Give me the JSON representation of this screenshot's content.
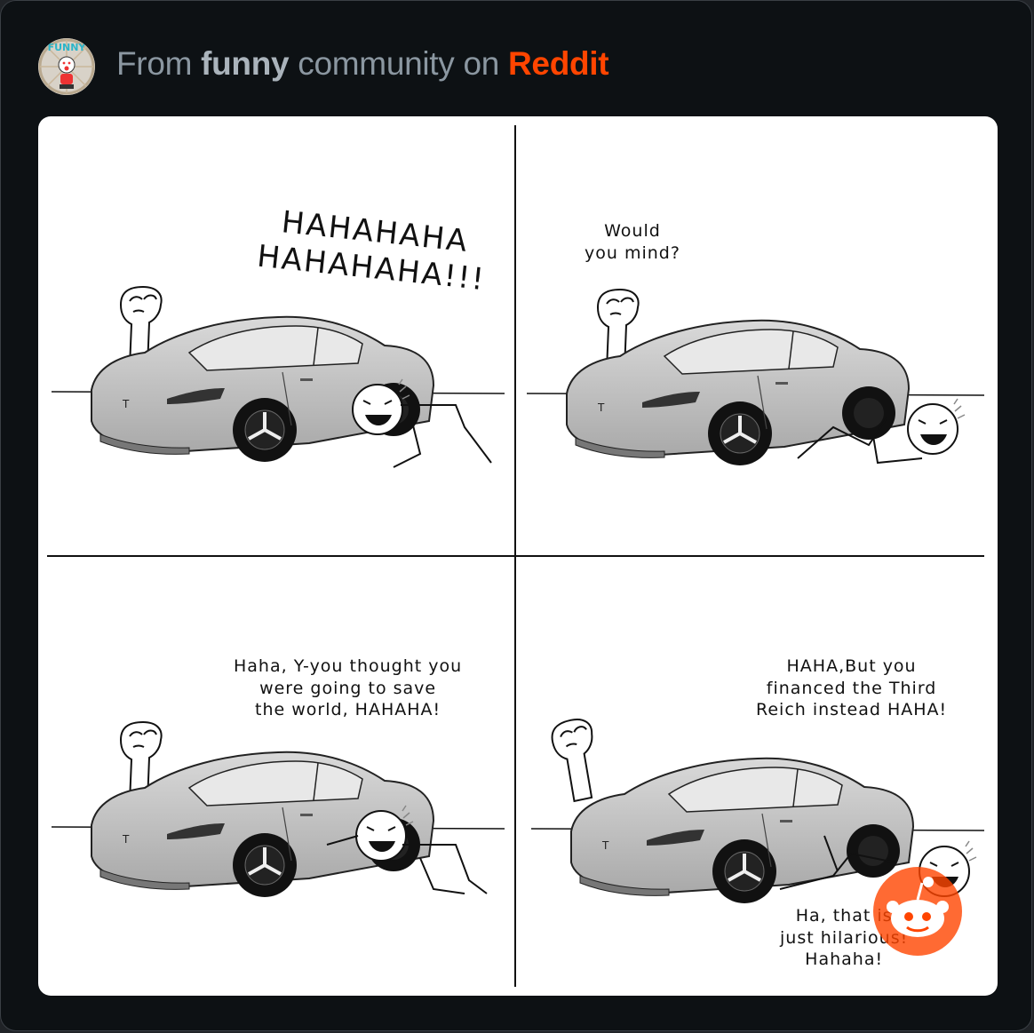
{
  "header": {
    "from": "From",
    "community": "funny",
    "middle": "community on",
    "platform": "Reddit"
  },
  "avatar": {
    "label": "FUNNY"
  },
  "comic": {
    "panels": [
      {
        "text": "HAHAHAHA\nHAHAHAHA!!!"
      },
      {
        "text": "Would\nyou mind?"
      },
      {
        "text": "Haha, Y-you thought you\nwere going to save\nthe world, HAHAHA!"
      },
      {
        "text": "HAHA,But you\nfinanced the Third\nReich instead HAHA!"
      }
    ],
    "caption": "Ha, that is\njust hilarious!\nHahaha!"
  },
  "colors": {
    "brand": "#ff4500",
    "background": "#0d1114"
  },
  "icons": {
    "overlay": "reddit-snoo-icon"
  }
}
